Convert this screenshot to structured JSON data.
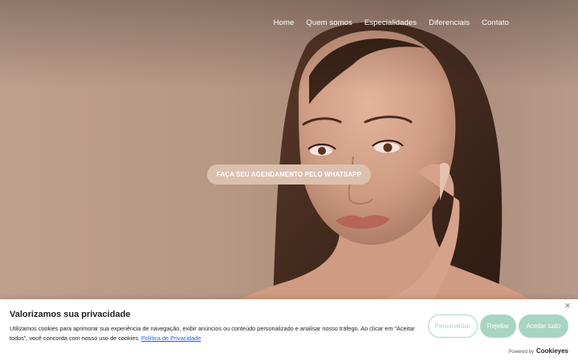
{
  "nav": {
    "items": [
      "Home",
      "Quem somos",
      "Especialidades",
      "Diferenciais",
      "Contato"
    ]
  },
  "hero": {
    "cta_label": "FAÇA SEU AGENDAMENTO PELO WHATSAPP"
  },
  "cookie_banner": {
    "title": "Valorizamos sua privacidade",
    "text": "Utilizamos cookies para aprimorar sua experiência de navegação, exibir anúncios ou conteúdo personalizado e analisar nosso tráfego. Ao clicar em \"Aceitar todos\", você concorda com nosso uso de cookies.",
    "policy_link": "Política de Privacidade",
    "buttons": {
      "customize": "Personalizar",
      "reject": "Rejeitar",
      "accept": "Aceitar tudo"
    },
    "powered_by": "Powered by",
    "powered_brand": "Cookieyes",
    "close_icon": "close-icon"
  },
  "colors": {
    "accent": "#a8d5c3",
    "cta_background": "#dcc0ae",
    "link": "#1863dc"
  }
}
